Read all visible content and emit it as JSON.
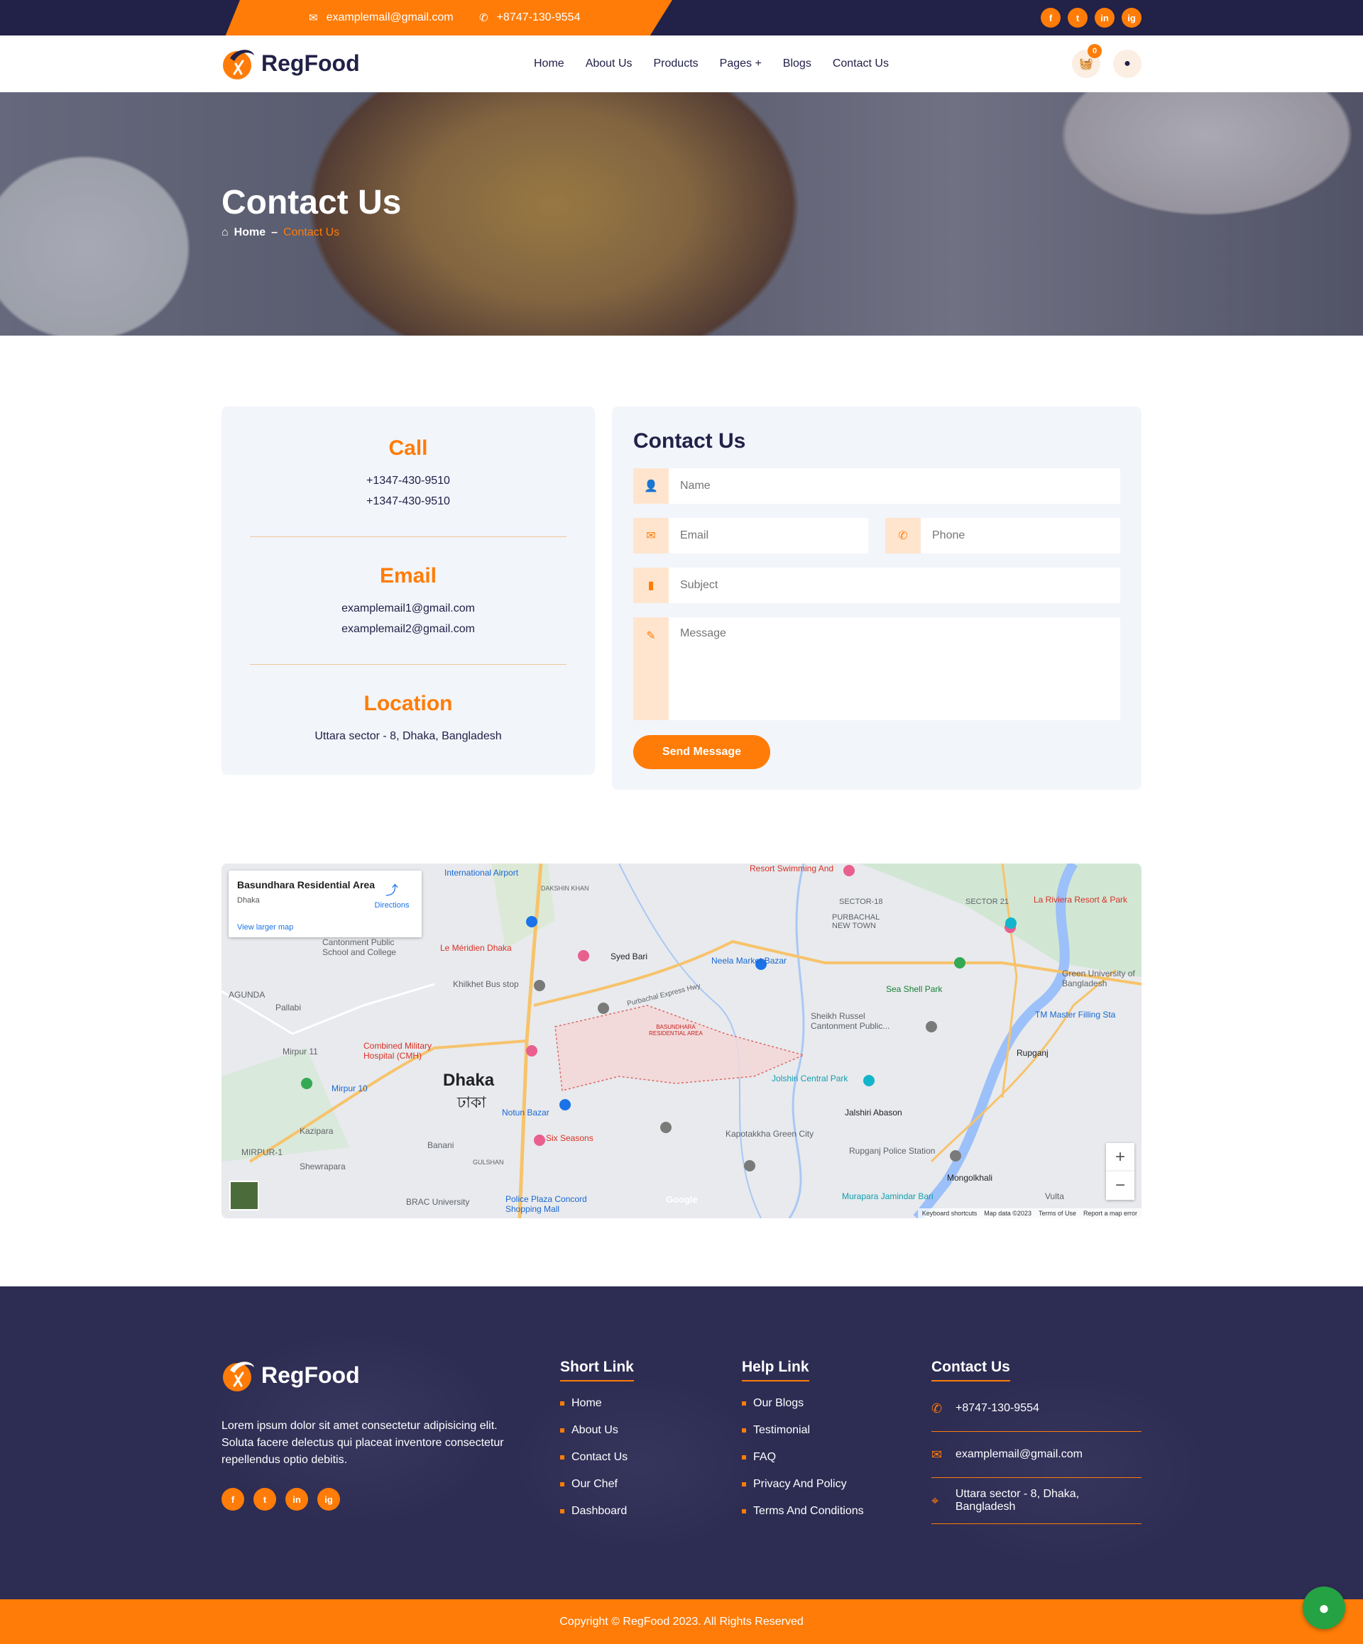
{
  "topbar": {
    "email": "examplemail@gmail.com",
    "phone": "+8747-130-9554",
    "social": [
      "f",
      "t",
      "in",
      "ig"
    ]
  },
  "header": {
    "logo": "RegFood",
    "nav": [
      "Home",
      "About Us",
      "Products",
      "Pages +",
      "Blogs",
      "Contact Us"
    ],
    "cart_count": "0"
  },
  "banner": {
    "title": "Contact Us",
    "crumb_home": "Home",
    "crumb_sep": "–",
    "crumb_current": "Contact Us"
  },
  "info": {
    "call_title": "Call",
    "call_1": "+1347-430-9510",
    "call_2": "+1347-430-9510",
    "email_title": "Email",
    "email_1": "examplemail1@gmail.com",
    "email_2": "examplemail2@gmail.com",
    "location_title": "Location",
    "location": "Uttara sector - 8, Dhaka, Bangladesh"
  },
  "form": {
    "title": "Contact Us",
    "name_placeholder": "Name",
    "email_placeholder": "Email",
    "phone_placeholder": "Phone",
    "subject_placeholder": "Subject",
    "message_placeholder": "Message",
    "send_label": "Send Message"
  },
  "map": {
    "place_title": "Basundhara Residential Area",
    "place_sub": "Dhaka",
    "directions": "Directions",
    "larger_map": "View larger map",
    "city": "Dhaka",
    "city_bn": "ঢাকা",
    "labels": [
      "Le Méridien Dhaka",
      "Khilkhet Bus stop",
      "Neela Market Bazar",
      "Sea Shell Park",
      "Sheikh Russel Cantonment Public...",
      "Jolshiri Central Park",
      "Jalshiri Abason",
      "Kapotakkha Green City",
      "Rupganj Police Station",
      "Mongolkhali",
      "Murapara Jamindar Bari",
      "Notun Bazar",
      "Six Seasons",
      "Police Plaza Concord Shopping Mall",
      "BRAC University",
      "Combined Military Hospital (CMH)",
      "Mirpur 10",
      "Kazipara",
      "Shewrapara",
      "Pallabi",
      "Mirpur 11",
      "Syed Bari",
      "SECTOR-18",
      "SECTOR 21",
      "PURBACHAL NEW TOWN",
      "La Riviera Resort & Park",
      "Green University of Bangladesh",
      "TM Master Filling Sta",
      "Rupganj",
      "Resort Swimming And",
      "International Airport",
      "Cantonment Public School and College",
      "AGUNDA",
      "MIRPUR-1",
      "Banani",
      "GULSHAN",
      "BASUNDHARA RESIDENTIAL AREA",
      "DAKSHIN KHAN",
      "Purbachal Express Hwy",
      "Vulta"
    ],
    "footer": [
      "Keyboard shortcuts",
      "Map data ©2023",
      "Terms of Use",
      "Report a map error"
    ],
    "google": "Google"
  },
  "footer": {
    "logo": "RegFood",
    "desc": "Lorem ipsum dolor sit amet consectetur adipisicing elit. Soluta facere delectus qui placeat inventore consectetur repellendus optio debitis.",
    "short_title": "Short Link",
    "short_links": [
      "Home",
      "About Us",
      "Contact Us",
      "Our Chef",
      "Dashboard"
    ],
    "help_title": "Help Link",
    "help_links": [
      "Our Blogs",
      "Testimonial",
      "FAQ",
      "Privacy And Policy",
      "Terms And Conditions"
    ],
    "contact_title": "Contact Us",
    "phone": "+8747-130-9554",
    "email": "examplemail@gmail.com",
    "address": "Uttara sector - 8, Dhaka, Bangladesh",
    "copyright": "Copyright © RegFood 2023. All Rights Reserved"
  },
  "colors": {
    "brand": "#ff7c08",
    "navy": "#222148"
  }
}
